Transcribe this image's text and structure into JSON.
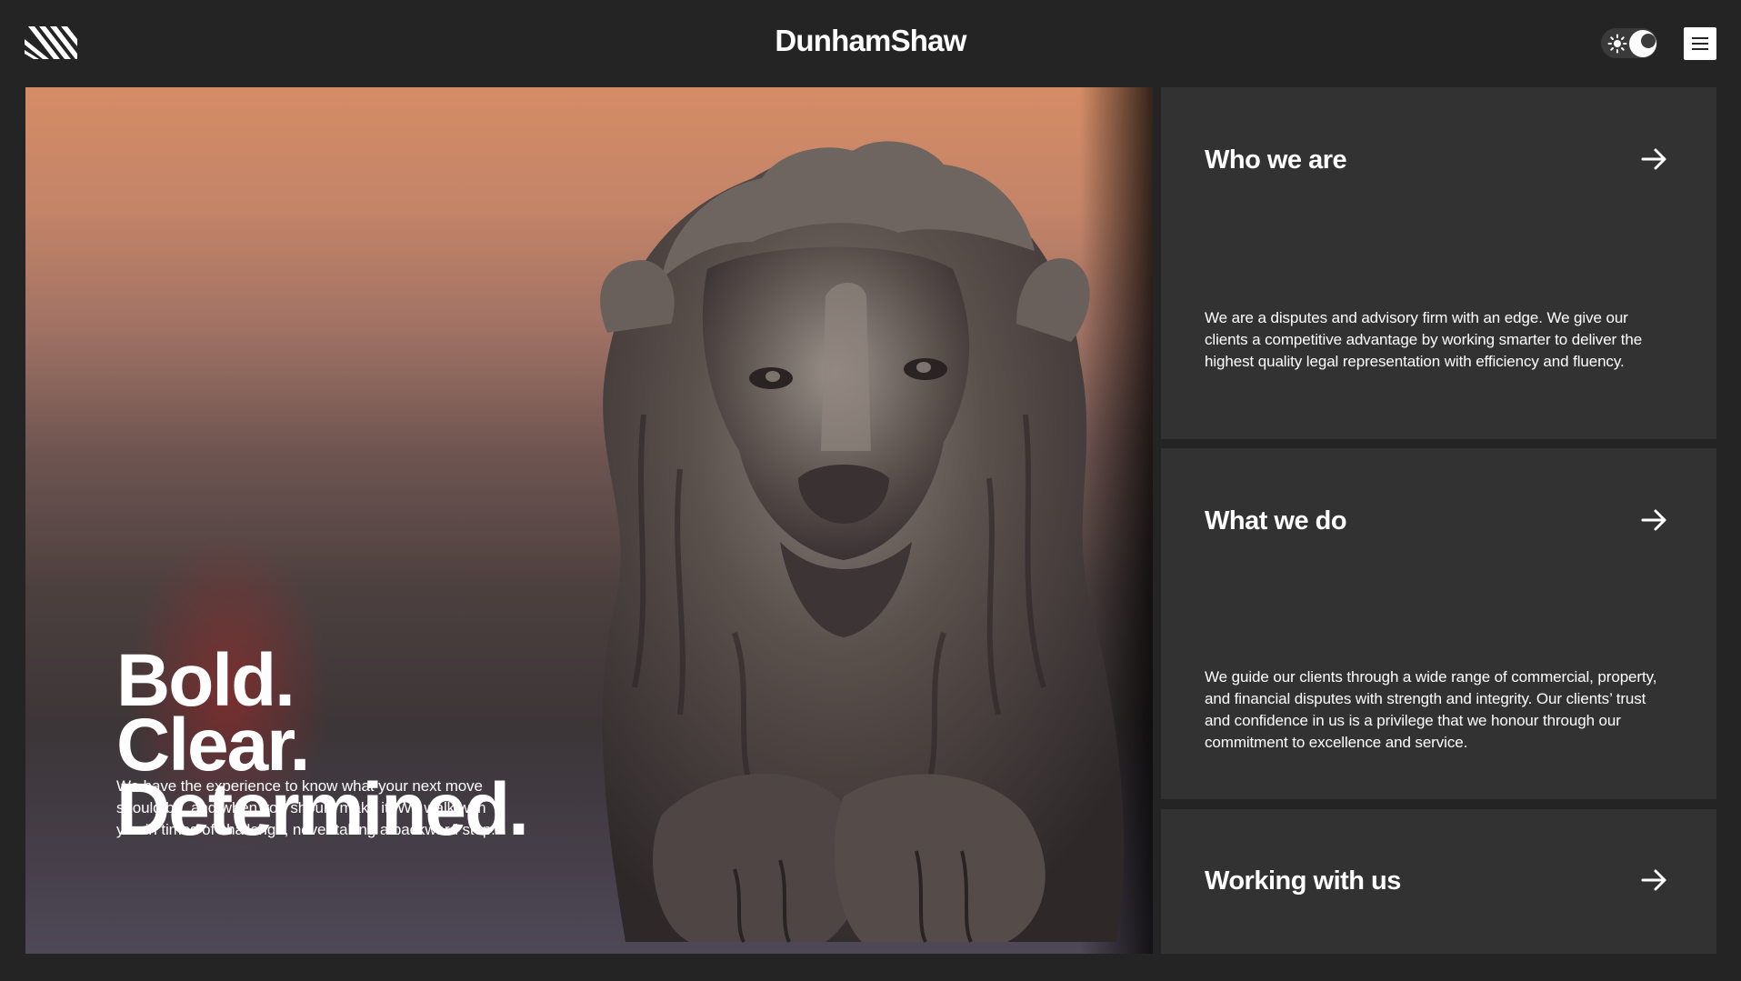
{
  "header": {
    "logo_icon": "diagonal-stripes-logo-icon",
    "brand": "DunhamShaw",
    "theme_toggle": {
      "sun_icon": "sun-icon",
      "moon_icon": "moon-icon",
      "active": "dark"
    },
    "menu_icon": "hamburger-menu-icon"
  },
  "hero": {
    "image": "bronze-lion-sculpture",
    "headline": [
      "Bold.",
      "Clear.",
      "Determined."
    ],
    "copy": "We have the experience to know what your next move should be, and when you should make it. We walk with you in times of challenge, never taking a backward step."
  },
  "cards": [
    {
      "title": "Who we are",
      "body": "We are a disputes and advisory firm with an edge. We give our clients a competitive advantage by working smarter to deliver the highest quality legal representation with efficiency and fluency.",
      "arrow_icon": "arrow-right-icon"
    },
    {
      "title": "What we do",
      "body": "We guide our clients through a wide range of commercial, property, and financial disputes with strength and integrity. Our clients’ trust and confidence in us is a privilege that we honour through our commitment to excellence and service.",
      "arrow_icon": "arrow-right-icon"
    },
    {
      "title": "Working with us",
      "arrow_icon": "arrow-right-icon"
    }
  ],
  "colors": {
    "background": "#242424",
    "card": "#323232",
    "text": "#ffffff"
  }
}
